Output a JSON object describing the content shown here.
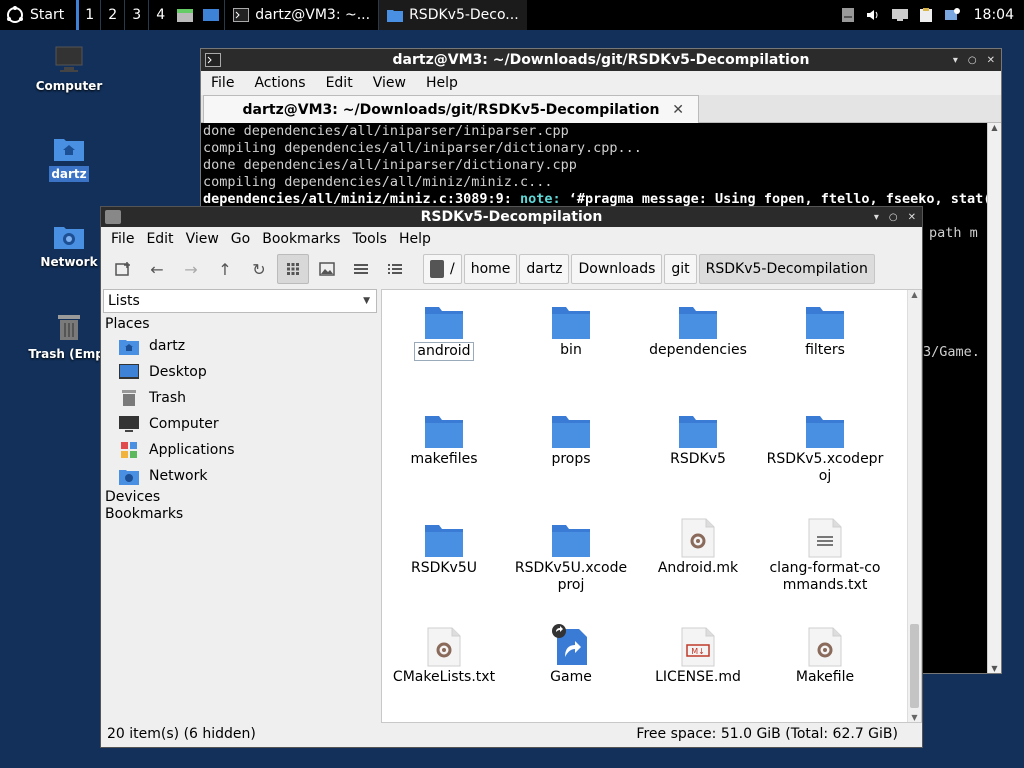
{
  "taskbar": {
    "start_label": "Start",
    "workspaces": [
      "1",
      "2",
      "3",
      "4"
    ],
    "tasks": [
      {
        "label": "dartz@VM3: ~..."
      },
      {
        "label": "RSDKv5-Deco..."
      }
    ],
    "clock": "18:04"
  },
  "desktop": {
    "icons": [
      {
        "label": "Computer"
      },
      {
        "label": "dartz"
      },
      {
        "label": "Network"
      },
      {
        "label": "Trash (Empt"
      }
    ]
  },
  "terminal": {
    "window_title": "dartz@VM3: ~/Downloads/git/RSDKv5-Decompilation",
    "menu": [
      "File",
      "Actions",
      "Edit",
      "View",
      "Help"
    ],
    "tab_title": "dartz@VM3: ~/Downloads/git/RSDKv5-Decompilation",
    "lines": [
      "done dependencies/all/iniparser/iniparser.cpp",
      "compiling dependencies/all/iniparser/dictionary.cpp...",
      "done dependencies/all/iniparser/dictionary.cpp",
      "compiling dependencies/all/miniz/miniz.c..."
    ],
    "warn_line": {
      "prefix": "dependencies/all/miniz/miniz.c:3089:9: ",
      "note": "note:",
      "msg": " ‘#pragma message: Using fopen, ftello, fseeko, stat("
    },
    "peek_1": "path m",
    "peek_2": "3/Game."
  },
  "file_manager": {
    "window_title": "RSDKv5-Decompilation",
    "menu": [
      "File",
      "Edit",
      "View",
      "Go",
      "Bookmarks",
      "Tools",
      "Help"
    ],
    "path": [
      "/",
      "home",
      "dartz",
      "Downloads",
      "git",
      "RSDKv5-Decompilation"
    ],
    "sidebar": {
      "mode": "Lists",
      "places_header": "Places",
      "places": [
        {
          "label": "dartz",
          "icon": "home-folder-icon"
        },
        {
          "label": "Desktop",
          "icon": "desktop-icon"
        },
        {
          "label": "Trash",
          "icon": "trash-icon"
        },
        {
          "label": "Computer",
          "icon": "computer-icon"
        },
        {
          "label": "Applications",
          "icon": "applications-icon"
        },
        {
          "label": "Network",
          "icon": "network-icon"
        }
      ],
      "devices_header": "Devices",
      "bookmarks_header": "Bookmarks"
    },
    "files": [
      {
        "name": "android",
        "type": "folder"
      },
      {
        "name": "bin",
        "type": "folder"
      },
      {
        "name": "dependencies",
        "type": "folder"
      },
      {
        "name": "filters",
        "type": "folder"
      },
      {
        "name": "makefiles",
        "type": "folder"
      },
      {
        "name": "props",
        "type": "folder"
      },
      {
        "name": "RSDKv5",
        "type": "folder"
      },
      {
        "name": "RSDKv5.xcodeproj",
        "type": "folder"
      },
      {
        "name": "RSDKv5U",
        "type": "folder"
      },
      {
        "name": "RSDKv5U.xcodeproj",
        "type": "folder"
      },
      {
        "name": "Android.mk",
        "type": "script"
      },
      {
        "name": "clang-format-commands.txt",
        "type": "text"
      },
      {
        "name": "CMakeLists.txt",
        "type": "script"
      },
      {
        "name": "Game",
        "type": "link"
      },
      {
        "name": "LICENSE.md",
        "type": "markdown"
      },
      {
        "name": "Makefile",
        "type": "script"
      }
    ],
    "status_left": "20 item(s) (6 hidden)",
    "status_right": "Free space: 51.0 GiB (Total: 62.7 GiB)"
  },
  "colors": {
    "desktop_bg": "#12305a",
    "folder": "#4a90e2",
    "folder_tab": "#3a7bd5",
    "selection": "#3b73c6"
  }
}
